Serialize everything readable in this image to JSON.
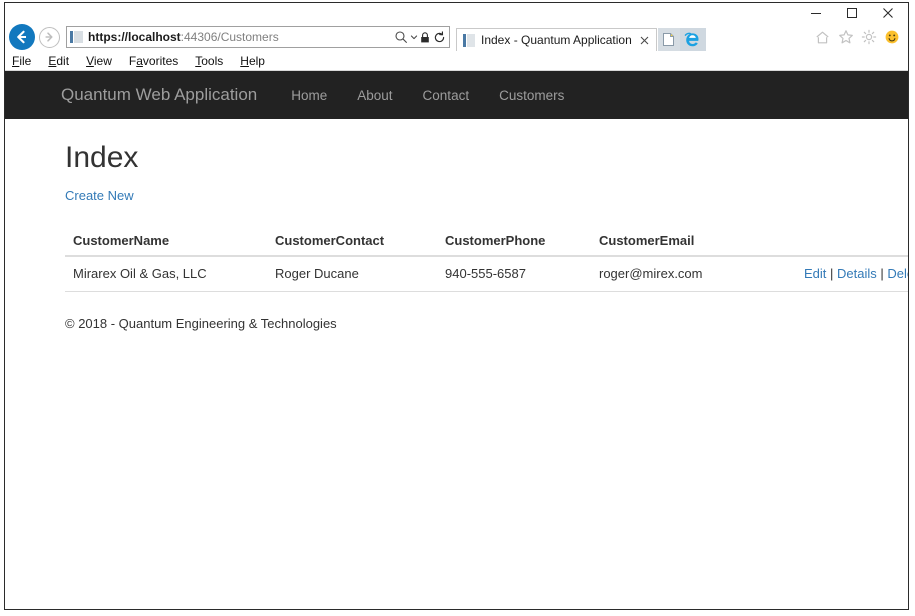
{
  "window": {
    "controls": {
      "minimize": "Minimize",
      "maximize": "Maximize",
      "close": "Close"
    }
  },
  "browser": {
    "back_label": "Back",
    "forward_label": "Forward",
    "address": {
      "scheme_host": "https://localhost",
      "path": ":44306/Customers",
      "full_url": "https://localhost:44306/Customers"
    },
    "address_icons": {
      "search": "search-icon",
      "search_caret": "chevron-down-icon",
      "lock": "lock-icon",
      "refresh": "refresh-icon"
    },
    "tab": {
      "title": "Index - Quantum Application",
      "close_label": "Close tab"
    },
    "new_tab_label": "New tab",
    "ie_logo_label": "Internet Explorer",
    "toolbar_icons": [
      {
        "name": "home-icon",
        "label": "Home"
      },
      {
        "name": "favorites-star-icon",
        "label": "Favorites"
      },
      {
        "name": "gear-icon",
        "label": "Tools"
      },
      {
        "name": "smiley-feedback-icon",
        "label": "Send feedback"
      }
    ],
    "menu": [
      {
        "label": "File",
        "accel_before": "",
        "accel": "F",
        "accel_after": "ile"
      },
      {
        "label": "Edit",
        "accel_before": "",
        "accel": "E",
        "accel_after": "dit"
      },
      {
        "label": "View",
        "accel_before": "",
        "accel": "V",
        "accel_after": "iew"
      },
      {
        "label": "Favorites",
        "accel_before": "F",
        "accel": "a",
        "accel_after": "vorites"
      },
      {
        "label": "Tools",
        "accel_before": "",
        "accel": "T",
        "accel_after": "ools"
      },
      {
        "label": "Help",
        "accel_before": "",
        "accel": "H",
        "accel_after": "elp"
      }
    ]
  },
  "site": {
    "brand": "Quantum Web Application",
    "nav_links": [
      {
        "label": "Home"
      },
      {
        "label": "About"
      },
      {
        "label": "Contact"
      },
      {
        "label": "Customers"
      }
    ],
    "navbar_bg": "#222222",
    "nav_text_color": "#9d9d9d"
  },
  "page": {
    "title": "Index",
    "create_new_label": "Create New",
    "link_color": "#337ab7",
    "table": {
      "headers": [
        "CustomerName",
        "CustomerContact",
        "CustomerPhone",
        "CustomerEmail",
        ""
      ],
      "rows": [
        {
          "name": "Mirarex Oil & Gas, LLC",
          "contact": "Roger Ducane",
          "phone": "940-555-6587",
          "email": "roger@mirex.com",
          "actions": {
            "edit": "Edit",
            "details": "Details",
            "delete": "Delete",
            "separator": "|"
          }
        }
      ]
    },
    "footer": "© 2018 - Quantum Engineering & Technologies"
  }
}
